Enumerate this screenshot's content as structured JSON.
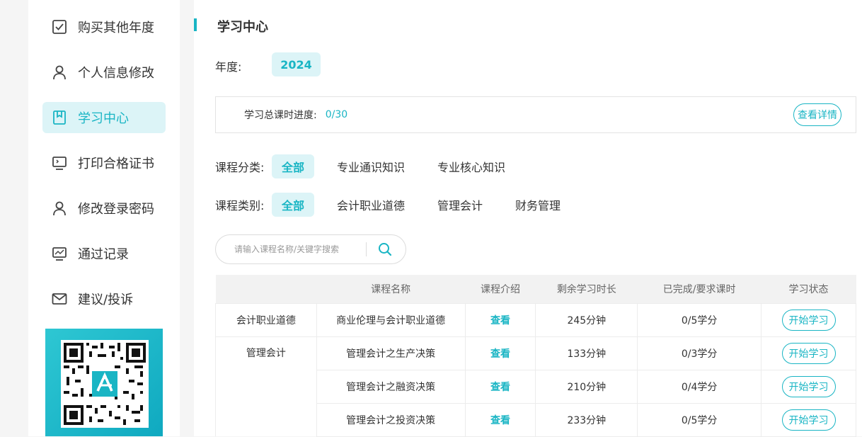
{
  "sidebar": {
    "items": [
      {
        "label": "购买其他年度",
        "icon": "checkbox-icon"
      },
      {
        "label": "个人信息修改",
        "icon": "user-icon"
      },
      {
        "label": "学习中心",
        "icon": "bookmark-icon",
        "active": true
      },
      {
        "label": "打印合格证书",
        "icon": "monitor-icon"
      },
      {
        "label": "修改登录密码",
        "icon": "user-icon"
      },
      {
        "label": "通过记录",
        "icon": "chart-icon"
      },
      {
        "label": "建议/投诉",
        "icon": "mail-icon"
      }
    ]
  },
  "page": {
    "title": "学习中心"
  },
  "year": {
    "label": "年度:",
    "value": "2024"
  },
  "progress": {
    "label": "学习总课时进度:",
    "value": "0/30",
    "detail_button": "查看详情"
  },
  "filters": {
    "category": {
      "label": "课程分类:",
      "options": [
        "全部",
        "专业通识知识",
        "专业核心知识"
      ],
      "active": 0
    },
    "type": {
      "label": "课程类别:",
      "options": [
        "全部",
        "会计职业道德",
        "管理会计",
        "财务管理"
      ],
      "active": 0
    }
  },
  "search": {
    "placeholder": "请输入课程名称/关键字搜索"
  },
  "table": {
    "headers": [
      "",
      "课程名称",
      "课程介绍",
      "剩余学习时长",
      "已完成/要求课时",
      "学习状态"
    ],
    "groups": [
      {
        "category": "会计职业道德",
        "rows": [
          {
            "name": "商业伦理与会计职业道德",
            "intro": "查看",
            "remaining": "245分钟",
            "progress": "0/5学分",
            "status": "开始学习"
          }
        ]
      },
      {
        "category": "管理会计",
        "rows": [
          {
            "name": "管理会计之生产决策",
            "intro": "查看",
            "remaining": "133分钟",
            "progress": "0/3学分",
            "status": "开始学习"
          },
          {
            "name": "管理会计之融资决策",
            "intro": "查看",
            "remaining": "210分钟",
            "progress": "0/4学分",
            "status": "开始学习"
          },
          {
            "name": "管理会计之投资决策",
            "intro": "查看",
            "remaining": "233分钟",
            "progress": "0/5学分",
            "status": "开始学习"
          }
        ]
      }
    ]
  },
  "colors": {
    "accent": "#19b5c4",
    "accent_light": "#dcf4f7"
  }
}
